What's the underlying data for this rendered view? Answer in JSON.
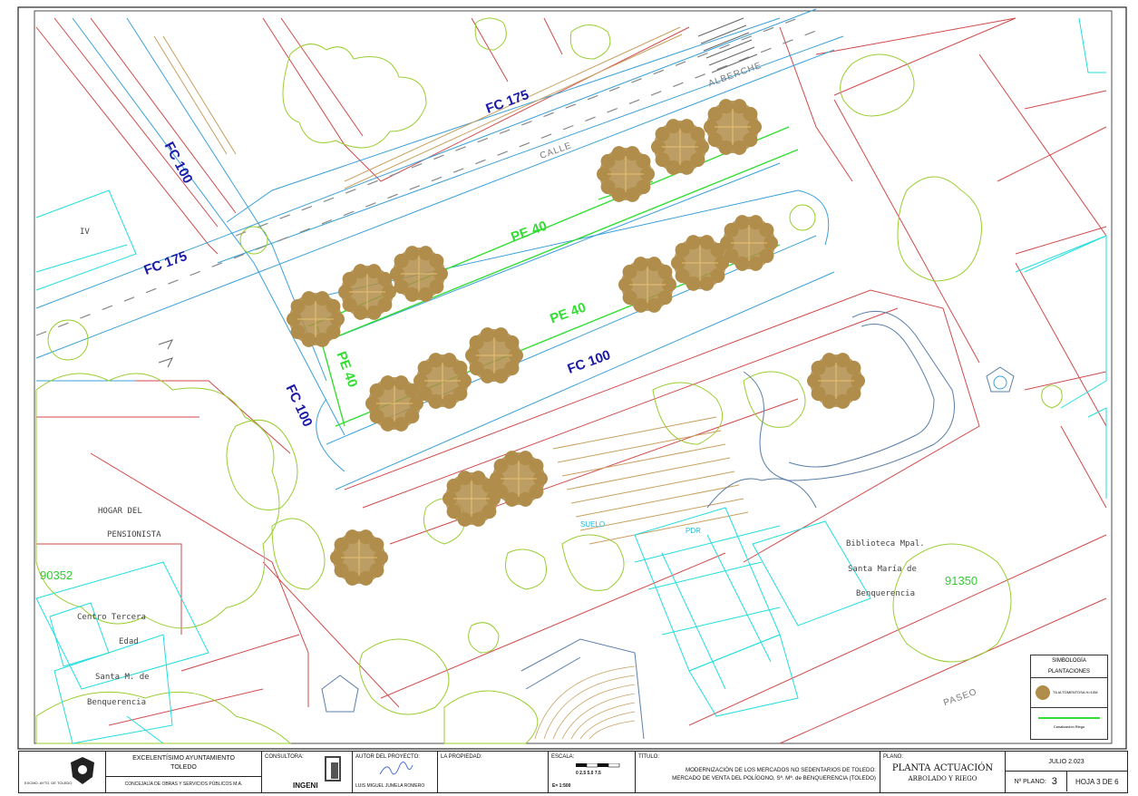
{
  "map_labels": {
    "fc175_top": "FC 175",
    "fc175_left": "FC 175",
    "fc100_left": "FC 100",
    "fc100_mid": "FC 100",
    "fc100_lower": "FC 100",
    "pe40_a": "PE 40",
    "pe40_b": "PE 40",
    "pe40_c": "PE 40",
    "calle": "CALLE",
    "alberche": "ALBERCHE",
    "paseo": "PASEO",
    "iv": "IV",
    "hogar_1": "HOGAR  DEL",
    "hogar_2": "PENSIONISTA",
    "centro_1": "Centro Tercera",
    "centro_2": "Edad",
    "centro_3": "Santa M. de",
    "centro_4": "Benquerencia",
    "biblio_1": "Biblioteca Mpal.",
    "biblio_2": "Santa María de",
    "biblio_3": "Benquerencia",
    "parcel_left": "90352",
    "parcel_right": "91350",
    "suelo": "SUELO",
    "pdr": "PDR"
  },
  "legend": {
    "title_1": "SIMBOLOGÍA",
    "title_2": "PLANTACIONES",
    "item_tree": "TILIA TOMENTOSA H>10M",
    "item_line": "Canalización Riego"
  },
  "title_block": {
    "org_1": "EXCELENTÍSIMO AYUNTAMIENTO",
    "org_2": "TOLEDO",
    "org_3": "CONCEJALÍA DE OBRAS Y SERVICIOS PÚBLICOS M.A.",
    "logo_caption": "EXCMO. AYTO. DE TOLEDO",
    "consultora_label": "CONSULTORA:",
    "consultora_name": "INGENI",
    "autor_label": "AUTOR DEL PROYECTO:",
    "autor_name": "LUIS MIGUEL JUMELA ROMERO",
    "propiedad_label": "LA PROPIEDAD:",
    "escala_label": "ESCALA:",
    "escala_ticks": "0   2.5  5.0  7.5",
    "escala_value": "E= 1:500",
    "titulo_label": "TÍTULO:",
    "titulo_1": "MODERNIZACIÓN DE LOS MERCADOS NO SEDENTARIOS DE TOLEDO:",
    "titulo_2": "MERCADO DE VENTA DEL POLÍGONO, Sª. Mª. de BENQUERENCIA (TOLEDO)",
    "plano_label": "PLANO:",
    "plano_1": "PLANTA ACTUACIÓN",
    "plano_2": "ARBOLADO Y RIEGO",
    "fecha": "JULIO 2.023",
    "nplano_label": "Nº PLANO:",
    "nplano_value": "3",
    "hoja": "HOJA 3 DE 6"
  },
  "colors": {
    "road": "#3aa0d8",
    "curb": "#d04a4a",
    "vegetation": "#9acd32",
    "tree": "#b08d4a",
    "irrigation": "#33dd33",
    "building": "#22dddd",
    "label_fc": "#1a1aa6"
  }
}
